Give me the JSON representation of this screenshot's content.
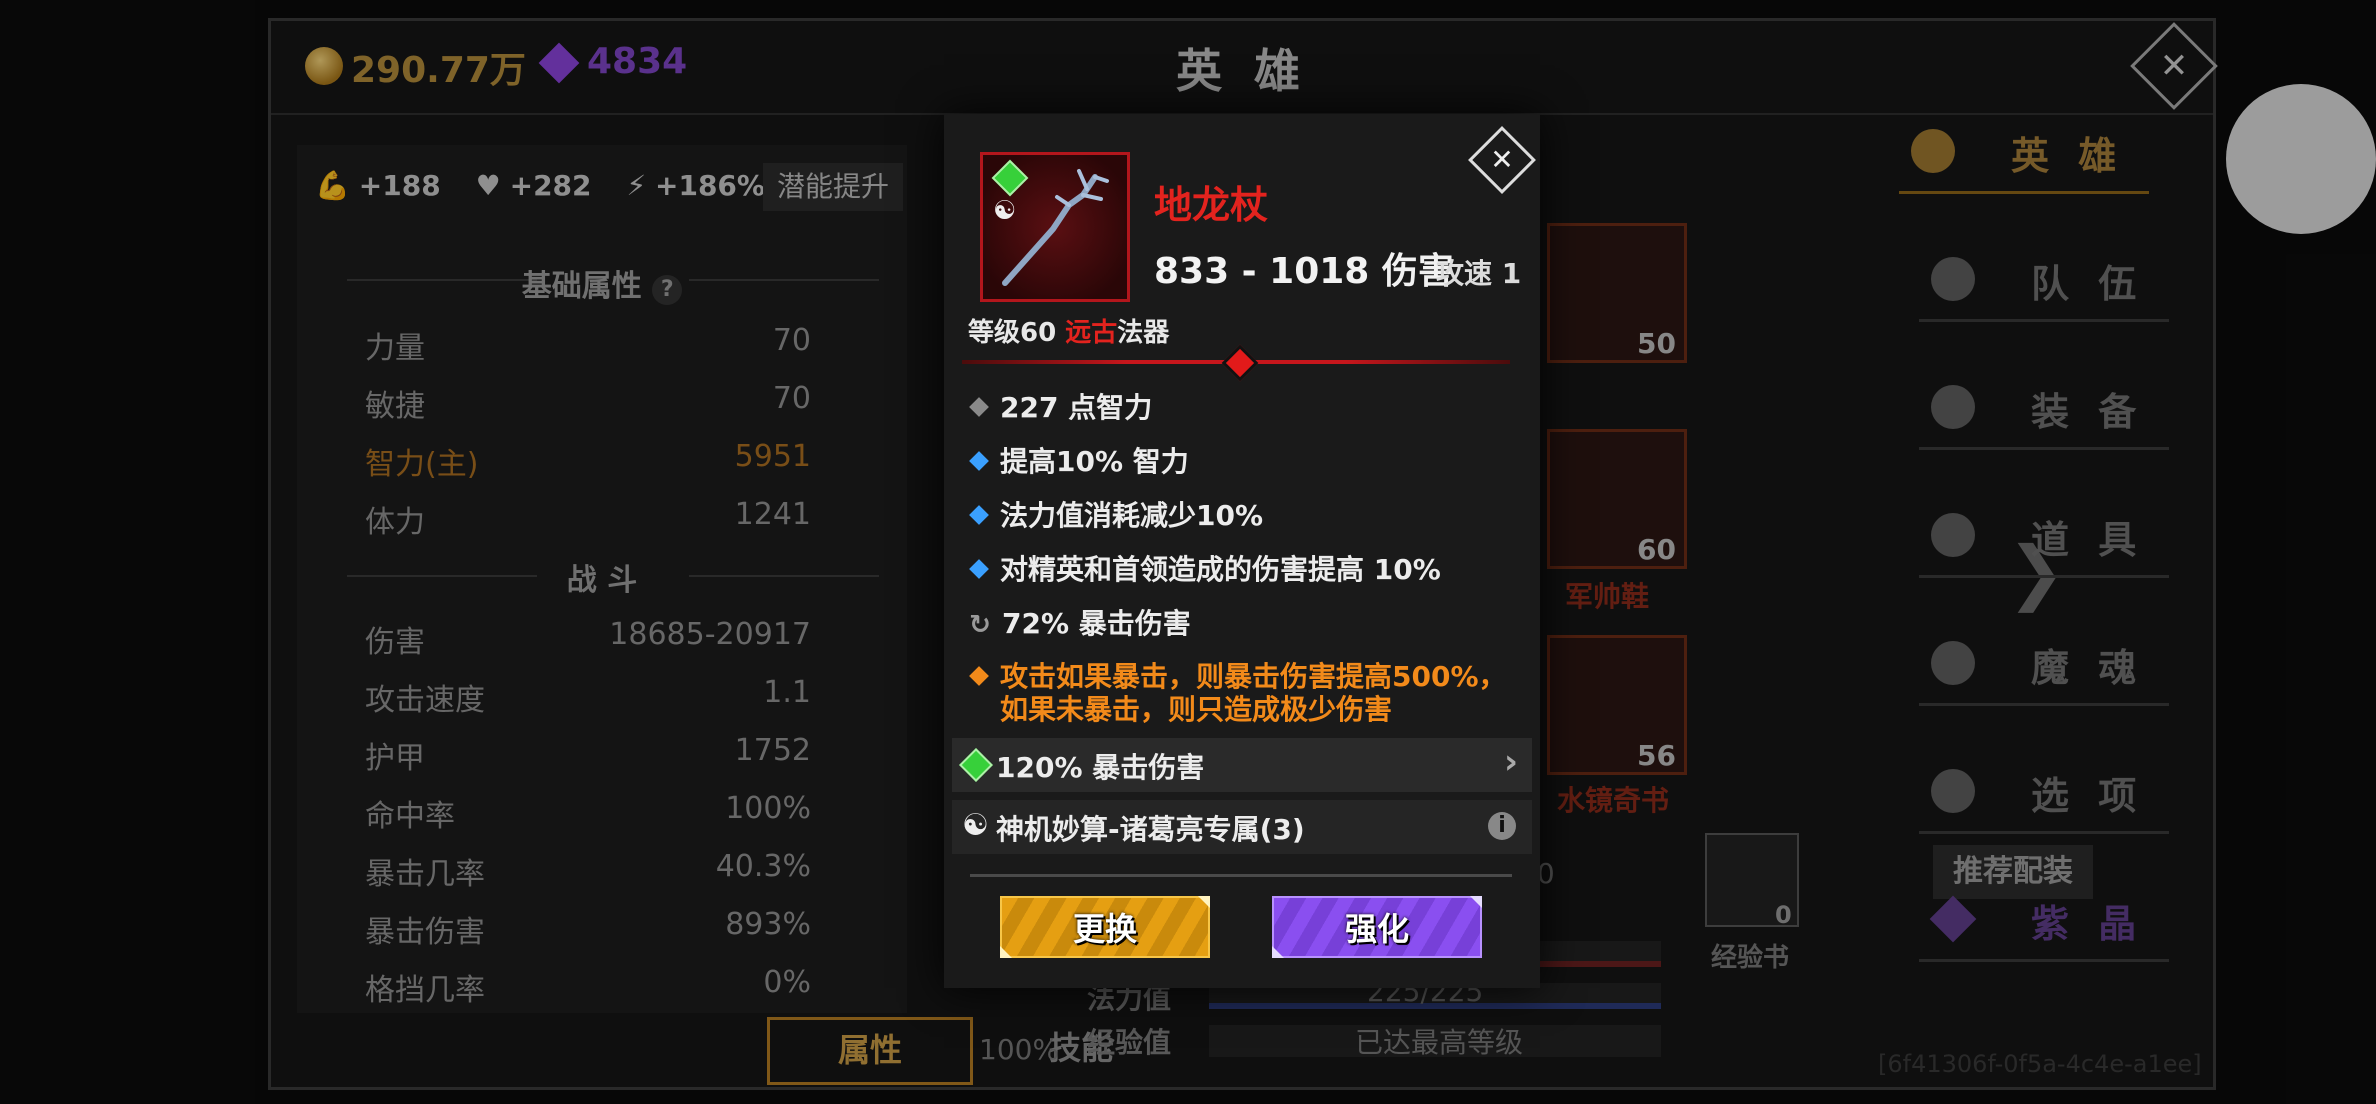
{
  "header": {
    "gold": "290.77万",
    "gems": "4834",
    "title": "英 雄"
  },
  "left_panel": {
    "potential": {
      "strength_bonus": "+188",
      "health_bonus": "+282",
      "speed_bonus": "+186%",
      "button": "潜能提升"
    },
    "basic_title": "基础属性",
    "help_icon": "?",
    "basic_stats": [
      {
        "label": "力量",
        "value": "70"
      },
      {
        "label": "敏捷",
        "value": "70"
      },
      {
        "label": "智力(主)",
        "value": "5951"
      },
      {
        "label": "体力",
        "value": "1241"
      }
    ],
    "combat_title": "战 斗",
    "combat_stats": [
      {
        "label": "伤害",
        "value": "18685-20917"
      },
      {
        "label": "攻击速度",
        "value": "1.1"
      },
      {
        "label": "护甲",
        "value": "1752"
      },
      {
        "label": "命中率",
        "value": "100%"
      },
      {
        "label": "暴击几率",
        "value": "40.3%"
      },
      {
        "label": "暴击伤害",
        "value": "893%"
      },
      {
        "label": "格挡几率",
        "value": "0%"
      }
    ],
    "tabs": {
      "attributes": "属性",
      "skills": "技能"
    }
  },
  "center_panel": {
    "slots": [
      {
        "level": "50",
        "name": ""
      },
      {
        "level": "60",
        "name": "军帅鞋"
      },
      {
        "level": "56",
        "name": "水镜奇书"
      }
    ],
    "recommend_button": "推荐配装",
    "crit_percent": "100%",
    "mana_label": "法力值",
    "mana_value": "225/225",
    "exp_label": "经验值",
    "exp_value": "已达最高等级",
    "exp_book_label": "经验书",
    "exp_book_count": "0",
    "obscured_number": "50"
  },
  "right_nav": [
    {
      "label": "英 雄",
      "icon": "heroes-icon",
      "active": true
    },
    {
      "label": "队 伍",
      "icon": "flag-icon"
    },
    {
      "label": "装 备",
      "icon": "helmet-icon"
    },
    {
      "label": "道 具",
      "icon": "bag-icon"
    },
    {
      "label": "魔 魂",
      "icon": "flame-icon"
    },
    {
      "label": "选 项",
      "icon": "gear-icon"
    },
    {
      "label": "紫 晶",
      "icon": "amethyst-icon"
    }
  ],
  "uuid": "[6f41306f-0f5a-4c4e-a1ee]",
  "popup": {
    "name": "地龙杖",
    "damage": "833 - 1018 伤害",
    "attack_speed": "攻速 1",
    "level_prefix": "等级60 ",
    "rarity": "远古",
    "type": "法器",
    "attributes": [
      {
        "text": "227 点智力",
        "kind": "grey"
      },
      {
        "text": "提高10% 智力",
        "kind": "blue"
      },
      {
        "text": "法力值消耗减少10%",
        "kind": "blue"
      },
      {
        "text": "对精英和首领造成的伤害提高 10%",
        "kind": "blue"
      },
      {
        "text": "72% 暴击伤害",
        "kind": "crit"
      }
    ],
    "legendary_line1": "攻击如果暴击，则暴击伤害提高500%，",
    "legendary_line2": "如果未暴击，则只造成极少伤害",
    "socket": "120% 暴击伤害",
    "set_bonus": "神机妙算-诸葛亮专属(3)",
    "replace_button": "更换",
    "enhance_button": "强化"
  },
  "colors": {
    "rarity_red": "#e3231e",
    "legendary_orange": "#f28a1a",
    "replace_gold": "#e59f12",
    "enhance_purple": "#8a4ff0"
  }
}
